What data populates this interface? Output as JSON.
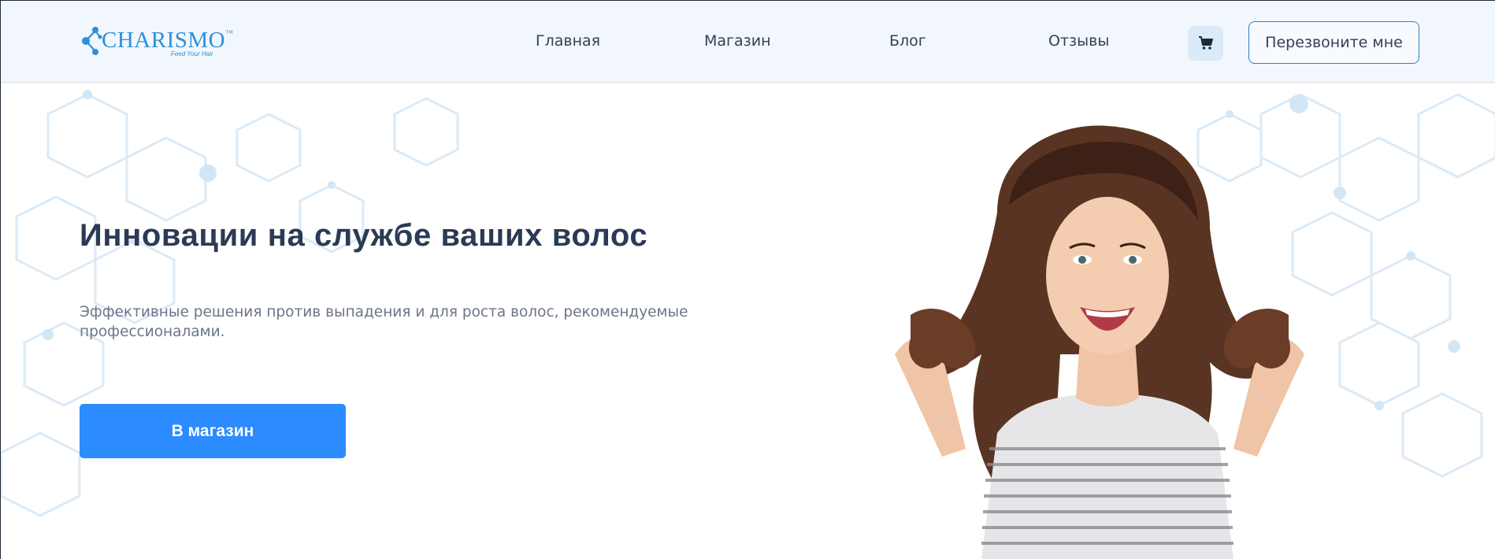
{
  "header": {
    "logo": {
      "name": "CHARISMO",
      "tm": "™",
      "tagline": "Feed Your Hair"
    },
    "nav": [
      {
        "label": "Главная"
      },
      {
        "label": "Магазин"
      },
      {
        "label": "Блог"
      },
      {
        "label": "Отзывы"
      }
    ],
    "cart_icon": "shopping-cart-icon",
    "callback_label": "Перезвоните мне"
  },
  "hero": {
    "title": "Инновации на службе ваших волос",
    "subtitle": "Эффективные решения против выпадения и для роста волос, рекомендуемые профессионалами.",
    "cta_label": "В магазин"
  },
  "colors": {
    "accent": "#2b8bff",
    "header_bg": "#f2f7fe",
    "title": "#2b3a55",
    "logo": "#2f8fd6"
  }
}
